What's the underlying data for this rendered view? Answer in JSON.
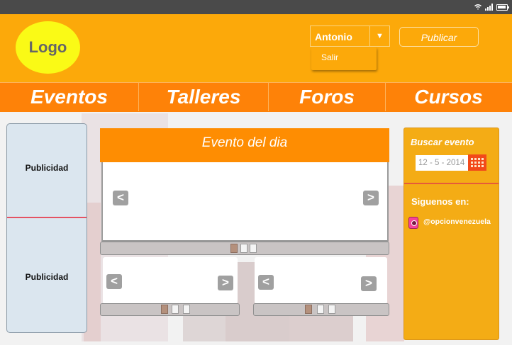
{
  "header": {
    "logo_text": "Logo",
    "user": {
      "name": "Antonio",
      "caret": "▼"
    },
    "user_menu": {
      "logout": "Salir"
    },
    "publish_label": "Publicar"
  },
  "nav": {
    "items": [
      {
        "label": "Eventos"
      },
      {
        "label": "Talleres"
      },
      {
        "label": "Foros"
      },
      {
        "label": "Cursos"
      }
    ]
  },
  "ads": {
    "top": "Publicidad",
    "bottom": "Publicidad"
  },
  "event": {
    "title": "Evento del dia",
    "prev": "<",
    "next": ">"
  },
  "search": {
    "title": "Buscar evento",
    "date_value": "12 - 5 - 2014"
  },
  "social": {
    "title": "Siguenos en:",
    "handle": "@opcionvenezuela"
  },
  "colors": {
    "header": "#fca90a",
    "navbar": "#fe8208",
    "logo": "#fafa16",
    "event_header": "#fe8d02",
    "side_panel": "#f4ac15",
    "ad_panel": "#dbe6ef"
  }
}
